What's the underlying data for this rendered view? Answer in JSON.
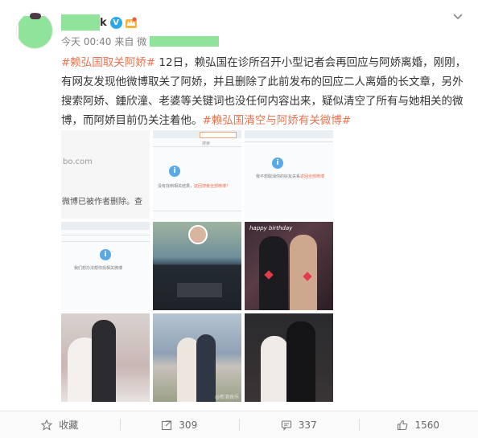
{
  "post": {
    "name_tail": "k",
    "time": "今天 00:40",
    "source_prefix": "来自 微",
    "text_parts": [
      {
        "type": "tag",
        "text": "#赖弘国取关阿娇#"
      },
      {
        "type": "plain",
        "text": " 12日，赖弘国在诊所召开小型记者会再回应与阿娇离婚，刚刚，有网友发现他微博取关了阿娇，并且删除了此前发布的回应二人离婚的长文章，另外搜索阿娇、鍾欣潼、老婆等关键词也没任何内容出来，疑似清空了所有与她相关的微博，而阿娇目前仍关注着他。"
      },
      {
        "type": "tag",
        "text": "#赖弘国清空与阿娇有关微博#"
      }
    ]
  },
  "images": {
    "cell1_top": "bo.com",
    "cell1_bottom": "微博已被作者删除。查",
    "cell2_search": "搜索",
    "cell2_msg": "没有找到相关结果，",
    "cell2_link": "返回搜索全部微博？",
    "cell3_msg": "我不想取消你的好友关系",
    "cell3_link": "返回全部微博",
    "cell4_msg": "我们想办法帮你找相关微博",
    "cell6_sign": "happy birthday",
    "watermark": "@新浪娱乐"
  },
  "footer": {
    "collect_label": "收藏",
    "repost_count": "309",
    "comment_count": "337",
    "like_count": "1560"
  },
  "colors": {
    "tag": "#eb7350",
    "verified": "#2aa7e6",
    "redaction": "#8fe49a"
  },
  "icons": [
    "star-icon",
    "repost-icon",
    "comment-icon",
    "like-icon",
    "chevron-down-icon",
    "verified-icon",
    "crown-icon",
    "info-icon"
  ]
}
